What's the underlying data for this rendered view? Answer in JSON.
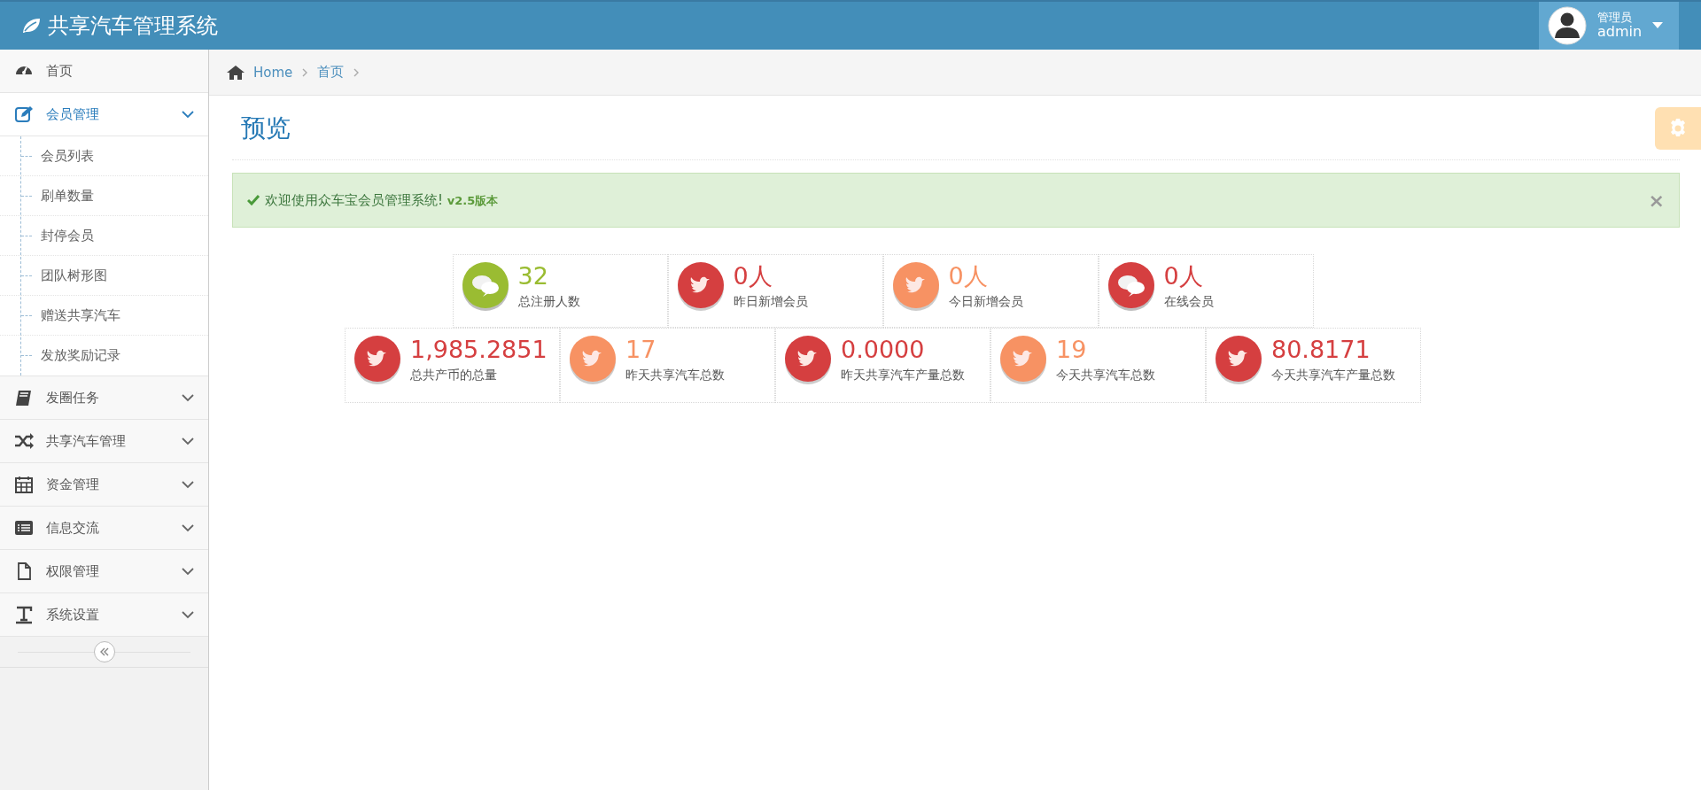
{
  "header": {
    "title": "共享汽车管理系统",
    "user": {
      "role": "管理员",
      "name": "admin"
    }
  },
  "sidebar": {
    "items": [
      {
        "label": "首页",
        "kind": "link",
        "selected": false
      },
      {
        "label": "会员管理",
        "kind": "menu",
        "selected": true,
        "expanded": true,
        "children": [
          {
            "label": "会员列表"
          },
          {
            "label": "刷单数量"
          },
          {
            "label": "封停会员"
          },
          {
            "label": "团队树形图"
          },
          {
            "label": "赠送共享汽车"
          },
          {
            "label": "发放奖励记录"
          }
        ]
      },
      {
        "label": "发圈任务",
        "kind": "menu",
        "selected": false,
        "expanded": false
      },
      {
        "label": "共享汽车管理",
        "kind": "menu",
        "selected": false,
        "expanded": false
      },
      {
        "label": "资金管理",
        "kind": "menu",
        "selected": false,
        "expanded": false
      },
      {
        "label": "信息交流",
        "kind": "menu",
        "selected": false,
        "expanded": false
      },
      {
        "label": "权限管理",
        "kind": "menu",
        "selected": false,
        "expanded": false
      },
      {
        "label": "系统设置",
        "kind": "menu",
        "selected": false,
        "expanded": false
      }
    ]
  },
  "breadcrumb": [
    "Home",
    "首页"
  ],
  "page_title": "预览",
  "alert": {
    "message": "欢迎使用众车宝会员管理系统! **v2.5版本**",
    "close": "×"
  },
  "stats": [
    [
      {
        "value": "32",
        "label": "总注册人数",
        "kind": "comments",
        "color": "#9abc32"
      },
      {
        "value": "0人",
        "label": "昨日新增会员",
        "kind": "bird",
        "color": "#d53f40"
      },
      {
        "value": "0人",
        "label": "今日新增会员",
        "kind": "bird",
        "color": "#f79263"
      },
      {
        "value": "0人",
        "label": "在线会员",
        "kind": "comments",
        "color": "#d53f40"
      }
    ],
    [
      {
        "value": "1,985.2851",
        "label": "总共产币的总量",
        "kind": "bird",
        "color": "#d53f40"
      },
      {
        "value": "17",
        "label": "昨天共享汽车总数",
        "kind": "bird",
        "color": "#f79263"
      },
      {
        "value": "0.0000",
        "label": "昨天共享汽车产量总数",
        "kind": "bird",
        "color": "#d53f40"
      },
      {
        "value": "19",
        "label": "今天共享汽车总数",
        "kind": "bird",
        "color": "#f79263"
      },
      {
        "value": "80.8171",
        "label": "今天共享汽车产量总数",
        "kind": "bird",
        "color": "#d53f40"
      }
    ]
  ]
}
